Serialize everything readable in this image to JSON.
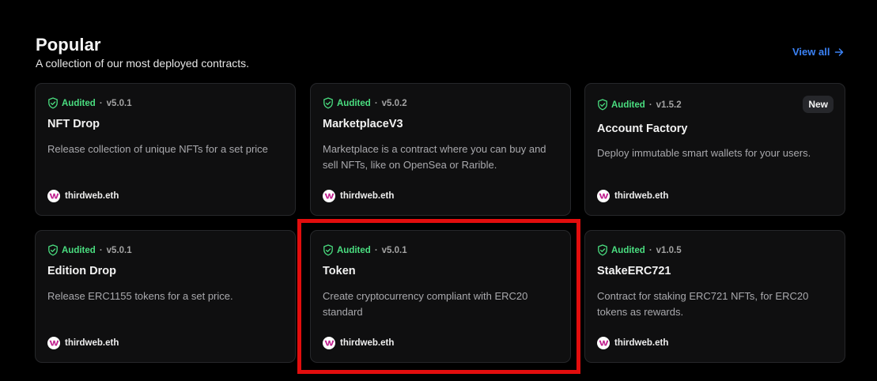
{
  "header": {
    "title": "Popular",
    "subtitle": "A collection of our most deployed contracts.",
    "view_all_label": "View all"
  },
  "colors": {
    "background": "#000000",
    "card_background": "#0f0f10",
    "card_border": "#26272a",
    "audited": "#4ade80",
    "link": "#3b82f6",
    "highlight": "#e20d0d"
  },
  "cards": [
    {
      "audit_label": "Audited",
      "separator": "·",
      "version": "v5.0.1",
      "name": "NFT Drop",
      "description": "Release collection of unique NFTs for a set price",
      "author": "thirdweb.eth",
      "badge": ""
    },
    {
      "audit_label": "Audited",
      "separator": "·",
      "version": "v5.0.2",
      "name": "MarketplaceV3",
      "description": "Marketplace is a contract where you can buy and sell NFTs, like on OpenSea or Rarible.",
      "author": "thirdweb.eth",
      "badge": ""
    },
    {
      "audit_label": "Audited",
      "separator": "·",
      "version": "v1.5.2",
      "name": "Account Factory",
      "description": "Deploy immutable smart wallets for your users.",
      "author": "thirdweb.eth",
      "badge": "New"
    },
    {
      "audit_label": "Audited",
      "separator": "·",
      "version": "v5.0.1",
      "name": "Edition Drop",
      "description": "Release ERC1155 tokens for a set price.",
      "author": "thirdweb.eth",
      "badge": ""
    },
    {
      "audit_label": "Audited",
      "separator": "·",
      "version": "v5.0.1",
      "name": "Token",
      "description": "Create cryptocurrency compliant with ERC20 standard",
      "author": "thirdweb.eth",
      "badge": ""
    },
    {
      "audit_label": "Audited",
      "separator": "·",
      "version": "v1.0.5",
      "name": "StakeERC721",
      "description": "Contract for staking ERC721 NFTs, for ERC20 tokens as rewards.",
      "author": "thirdweb.eth",
      "badge": ""
    }
  ],
  "icons": {
    "audit": "shield-check-icon",
    "author": "thirdweb-logo-icon",
    "view_all": "arrow-right-icon"
  }
}
